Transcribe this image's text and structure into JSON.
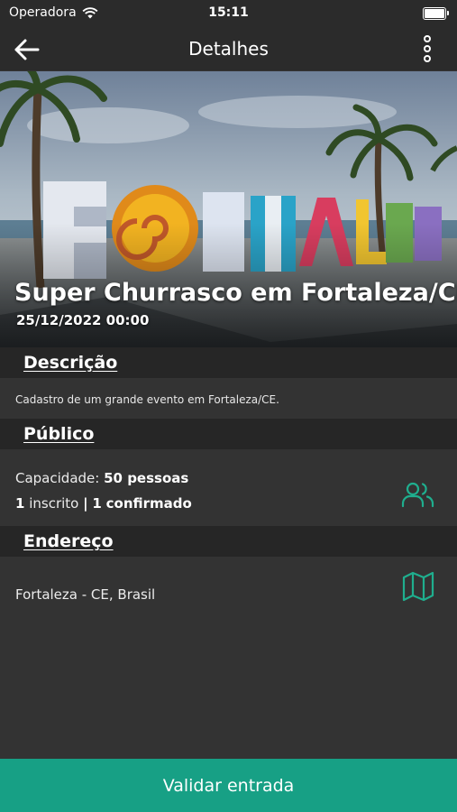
{
  "status_bar": {
    "carrier": "Operadora",
    "time": "15:11"
  },
  "nav": {
    "title": "Detalhes",
    "back_icon": "arrow-left-icon",
    "menu_icon": "more-vertical-icon"
  },
  "event": {
    "title": "Super Churrasco em Fortaleza/CE",
    "date": "25/12/2022 00:00",
    "image_sign_text": "FORTALEZA"
  },
  "descricao": {
    "header": "Descrição",
    "text": "Cadastro de um grande evento em Fortaleza/CE."
  },
  "publico": {
    "header": "Público",
    "capacity_label": "Capacidade:",
    "capacity_value": "50 pessoas",
    "inscritos_count": "1",
    "inscritos_label": "inscrito",
    "separator": "|",
    "confirmados_count": "1",
    "confirmados_label": "confirmado",
    "icon": "people-icon"
  },
  "endereco": {
    "header": "Endereço",
    "text": "Fortaleza - CE, Brasil",
    "icon": "map-icon"
  },
  "footer": {
    "button_label": "Validar entrada"
  },
  "colors": {
    "accent": "#17a085",
    "icon": "#1fae8e",
    "background": "#333333",
    "header_bg": "#262626"
  }
}
